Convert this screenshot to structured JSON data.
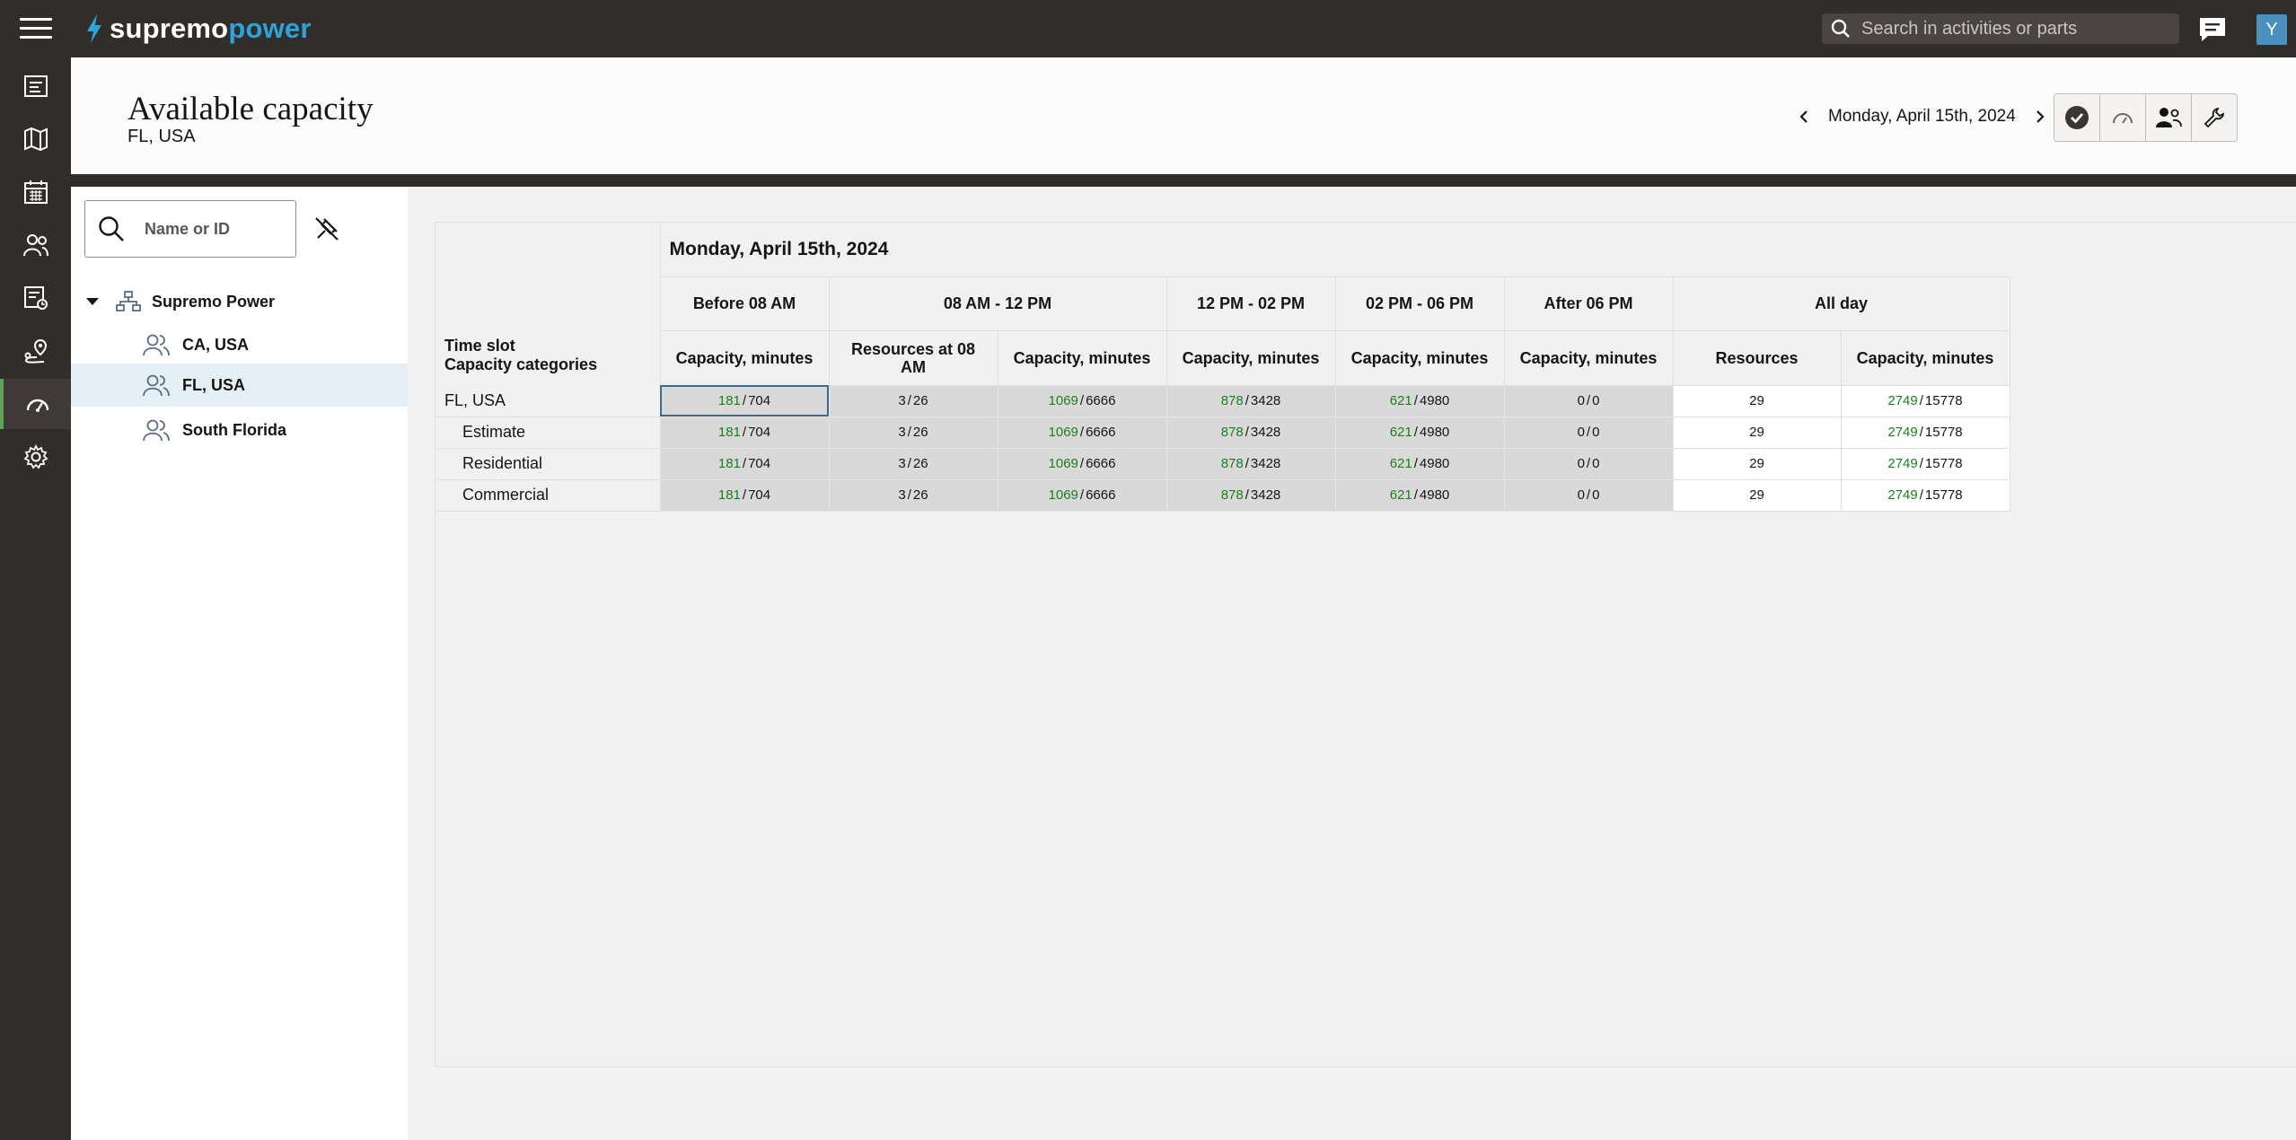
{
  "brand": {
    "word1": "supremo",
    "word2": "power",
    "accent": "#2fa2d8"
  },
  "topbar": {
    "search_placeholder": "Search in activities or parts",
    "avatar_initial": "Y"
  },
  "rail": {
    "items": [
      "activities-icon",
      "map-icon",
      "calendar-icon",
      "resources-icon",
      "dispatch-icon",
      "routing-icon",
      "capacity-icon",
      "settings-icon"
    ],
    "active": "capacity-icon"
  },
  "header": {
    "title": "Available capacity",
    "subtitle": "FL, USA",
    "date": "Monday, April 15th, 2024",
    "prev_label": "‹",
    "next_label": "›"
  },
  "left_panel": {
    "search_placeholder": "Name or ID",
    "tree": {
      "root": "Supremo Power",
      "children": [
        "CA, USA",
        "FL, USA",
        "South Florida"
      ],
      "selected": "FL, USA"
    }
  },
  "grid": {
    "date_header": "Monday, April 15th, 2024",
    "corner": [
      "Time slot",
      "Capacity categories"
    ],
    "slots": [
      "Before 08 AM",
      "08 AM - 12 PM",
      "12 PM - 02 PM",
      "02 PM - 06 PM",
      "After 06 PM",
      "All day"
    ],
    "subheaders": [
      "Capacity, minutes",
      "Resources at 08 AM",
      "Capacity, minutes",
      "Capacity, minutes",
      "Capacity, minutes",
      "Capacity, minutes",
      "Resources",
      "Capacity, minutes"
    ],
    "rows": [
      {
        "label": "FL, USA",
        "indent": false,
        "cells": [
          [
            "181",
            "704"
          ],
          [
            "3",
            "26"
          ],
          [
            "1069",
            "6666"
          ],
          [
            "878",
            "3428"
          ],
          [
            "621",
            "4980"
          ],
          [
            "0",
            "0"
          ],
          [
            "29",
            ""
          ],
          [
            "2749",
            "15778"
          ]
        ]
      },
      {
        "label": "Estimate",
        "indent": true,
        "cells": [
          [
            "181",
            "704"
          ],
          [
            "3",
            "26"
          ],
          [
            "1069",
            "6666"
          ],
          [
            "878",
            "3428"
          ],
          [
            "621",
            "4980"
          ],
          [
            "0",
            "0"
          ],
          [
            "29",
            ""
          ],
          [
            "2749",
            "15778"
          ]
        ]
      },
      {
        "label": "Residential",
        "indent": true,
        "cells": [
          [
            "181",
            "704"
          ],
          [
            "3",
            "26"
          ],
          [
            "1069",
            "6666"
          ],
          [
            "878",
            "3428"
          ],
          [
            "621",
            "4980"
          ],
          [
            "0",
            "0"
          ],
          [
            "29",
            ""
          ],
          [
            "2749",
            "15778"
          ]
        ]
      },
      {
        "label": "Commercial",
        "indent": true,
        "cells": [
          [
            "181",
            "704"
          ],
          [
            "3",
            "26"
          ],
          [
            "1069",
            "6666"
          ],
          [
            "878",
            "3428"
          ],
          [
            "621",
            "4980"
          ],
          [
            "0",
            "0"
          ],
          [
            "29",
            ""
          ],
          [
            "2749",
            "15778"
          ]
        ]
      }
    ],
    "colors": {
      "available": "#1a7f1a",
      "cell_gray": "#d9d9d9"
    }
  }
}
